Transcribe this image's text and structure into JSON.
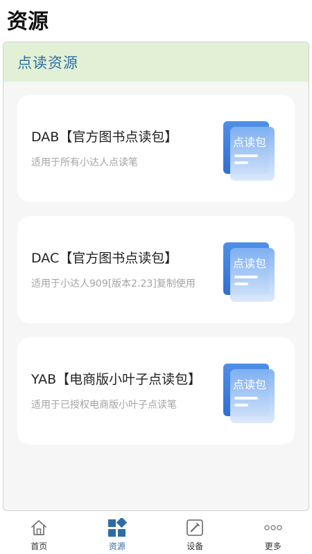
{
  "page": {
    "title": "资源"
  },
  "panel": {
    "header": "点读资源"
  },
  "cards": [
    {
      "title": "DAB【官方图书点读包】",
      "subtitle": "适用于所有小达人点读笔",
      "icon": "reading-pack-icon",
      "icon_text": "点读包"
    },
    {
      "title": "DAC【官方图书点读包】",
      "subtitle": "适用于小达人909[版本2.23]复制使用",
      "icon": "reading-pack-icon",
      "icon_text": "点读包"
    },
    {
      "title": "YAB【电商版小叶子点读包】",
      "subtitle": "适用于已授权电商版小叶子点读笔",
      "icon": "reading-pack-icon",
      "icon_text": "点读包"
    }
  ],
  "nav": {
    "active": "resources",
    "items": [
      {
        "label": "首页",
        "icon": "home-icon"
      },
      {
        "label": "资源",
        "icon": "resources-icon"
      },
      {
        "label": "设备",
        "icon": "device-icon"
      },
      {
        "label": "更多",
        "icon": "more-icon"
      }
    ]
  },
  "colors": {
    "accent": "#2d6da6",
    "header_bg": "#e2f0d6",
    "icon_blue": "#4a8fe6"
  }
}
